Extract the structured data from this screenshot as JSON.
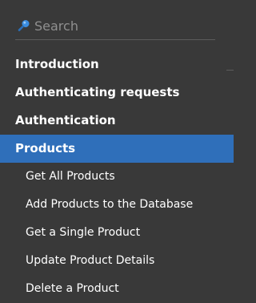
{
  "search": {
    "placeholder": "Search"
  },
  "nav": {
    "items": [
      {
        "label": "Introduction"
      },
      {
        "label": "Authenticating requests"
      },
      {
        "label": "Authentication"
      },
      {
        "label": "Products"
      }
    ],
    "sub_items": [
      {
        "label": "Get All Products"
      },
      {
        "label": "Add Products to the Database"
      },
      {
        "label": "Get a Single Product"
      },
      {
        "label": "Update Product Details"
      },
      {
        "label": "Delete a Product"
      }
    ]
  },
  "colors": {
    "background": "#393939",
    "active": "#2f6fba",
    "search_icon": "#3b8de0"
  }
}
